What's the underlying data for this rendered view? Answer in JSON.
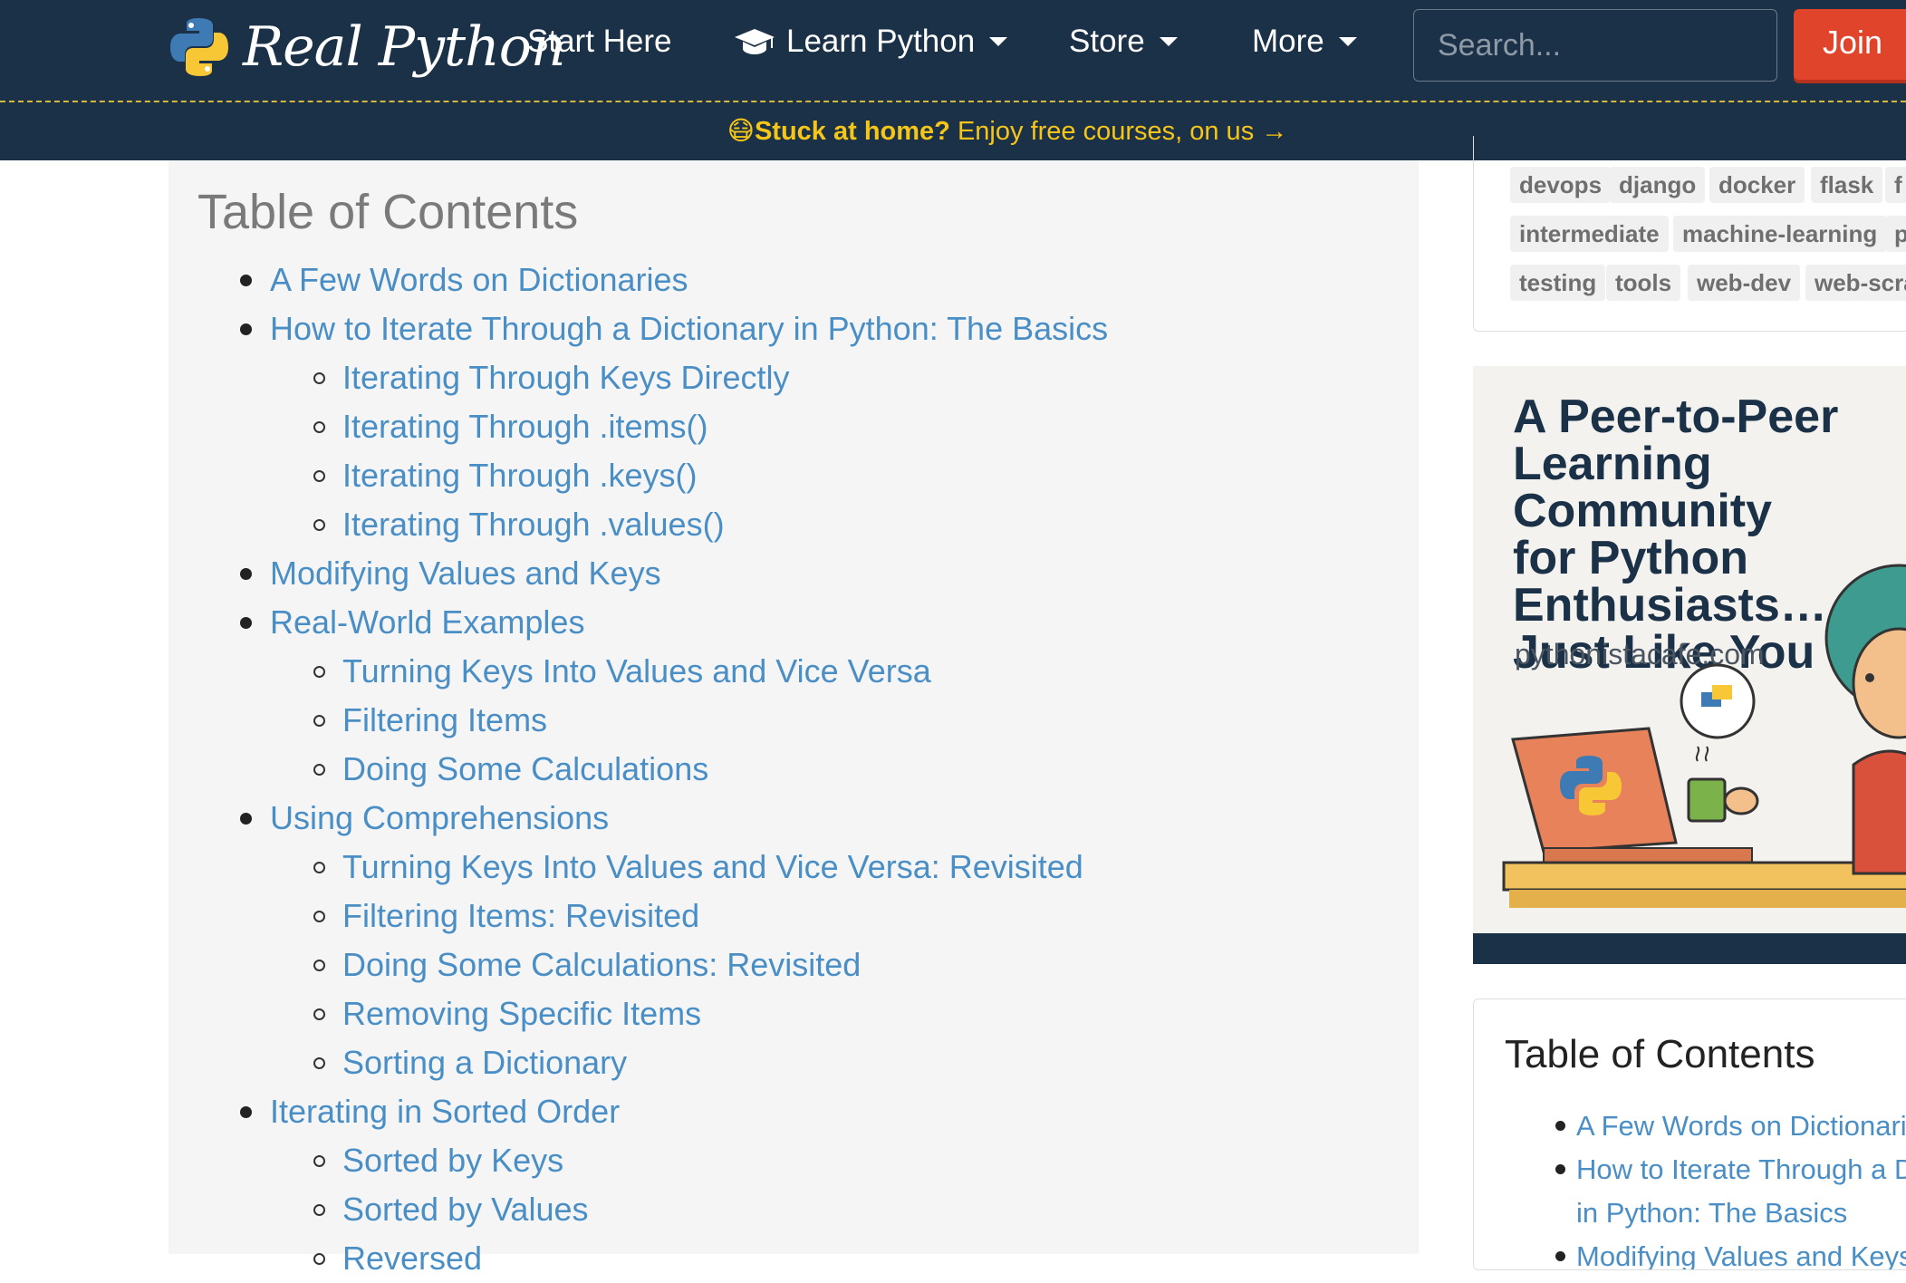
{
  "nav": {
    "logo_text": "Real Python",
    "items": [
      {
        "label": "Start Here",
        "caret": false,
        "icon": ""
      },
      {
        "label": "Learn Python",
        "caret": true,
        "icon": "graduation-cap-icon"
      },
      {
        "label": "Store",
        "caret": true,
        "icon": ""
      },
      {
        "label": "More",
        "caret": true,
        "icon": ""
      }
    ],
    "search_placeholder": "Search...",
    "join_label": "Join"
  },
  "announcement": {
    "emoji": "😷",
    "bold": "Stuck at home?",
    "text": " Enjoy free courses, on us →"
  },
  "toc": {
    "title": "Table of Contents",
    "items": [
      {
        "level": 1,
        "label": "A Few Words on Dictionaries"
      },
      {
        "level": 1,
        "label": "How to Iterate Through a Dictionary in Python: The Basics"
      },
      {
        "level": 2,
        "label": "Iterating Through Keys Directly"
      },
      {
        "level": 2,
        "label": "Iterating Through .items()"
      },
      {
        "level": 2,
        "label": "Iterating Through .keys()"
      },
      {
        "level": 2,
        "label": "Iterating Through .values()"
      },
      {
        "level": 1,
        "label": "Modifying Values and Keys"
      },
      {
        "level": 1,
        "label": "Real-World Examples"
      },
      {
        "level": 2,
        "label": "Turning Keys Into Values and Vice Versa"
      },
      {
        "level": 2,
        "label": "Filtering Items"
      },
      {
        "level": 2,
        "label": "Doing Some Calculations"
      },
      {
        "level": 1,
        "label": "Using Comprehensions"
      },
      {
        "level": 2,
        "label": "Turning Keys Into Values and Vice Versa: Revisited"
      },
      {
        "level": 2,
        "label": "Filtering Items: Revisited"
      },
      {
        "level": 2,
        "label": "Doing Some Calculations: Revisited"
      },
      {
        "level": 2,
        "label": "Removing Specific Items"
      },
      {
        "level": 2,
        "label": "Sorting a Dictionary"
      },
      {
        "level": 1,
        "label": "Iterating in Sorted Order"
      },
      {
        "level": 2,
        "label": "Sorted by Keys"
      },
      {
        "level": 2,
        "label": "Sorted by Values"
      },
      {
        "level": 2,
        "label": "Reversed"
      }
    ]
  },
  "sidebar": {
    "tag_rows": [
      [
        "devops",
        "django",
        "docker",
        "flask",
        "f"
      ],
      [
        "intermediate",
        "machine-learning",
        "p"
      ],
      [
        "testing",
        "tools",
        "web-dev",
        "web-scra"
      ]
    ],
    "ad": {
      "headline": "A Peer-to-Peer\nLearning Community\nfor Python\nEnthusiasts…\nJust Like You",
      "url": "pythonistacafe.com"
    },
    "toc_title": "Table of Contents",
    "toc_items": [
      {
        "label": "A Few Words on Dictionaries",
        "bullet": true
      },
      {
        "label": "How to Iterate Through a Dictionary",
        "bullet": true
      },
      {
        "label": "in Python: The Basics",
        "bullet": false
      },
      {
        "label": "Modifying Values and Keys",
        "bullet": true
      }
    ]
  },
  "colors": {
    "navbar": "#1b3147",
    "link": "#4a8ec6",
    "accent_yellow": "#f5c518",
    "join_red": "#e0442b"
  }
}
